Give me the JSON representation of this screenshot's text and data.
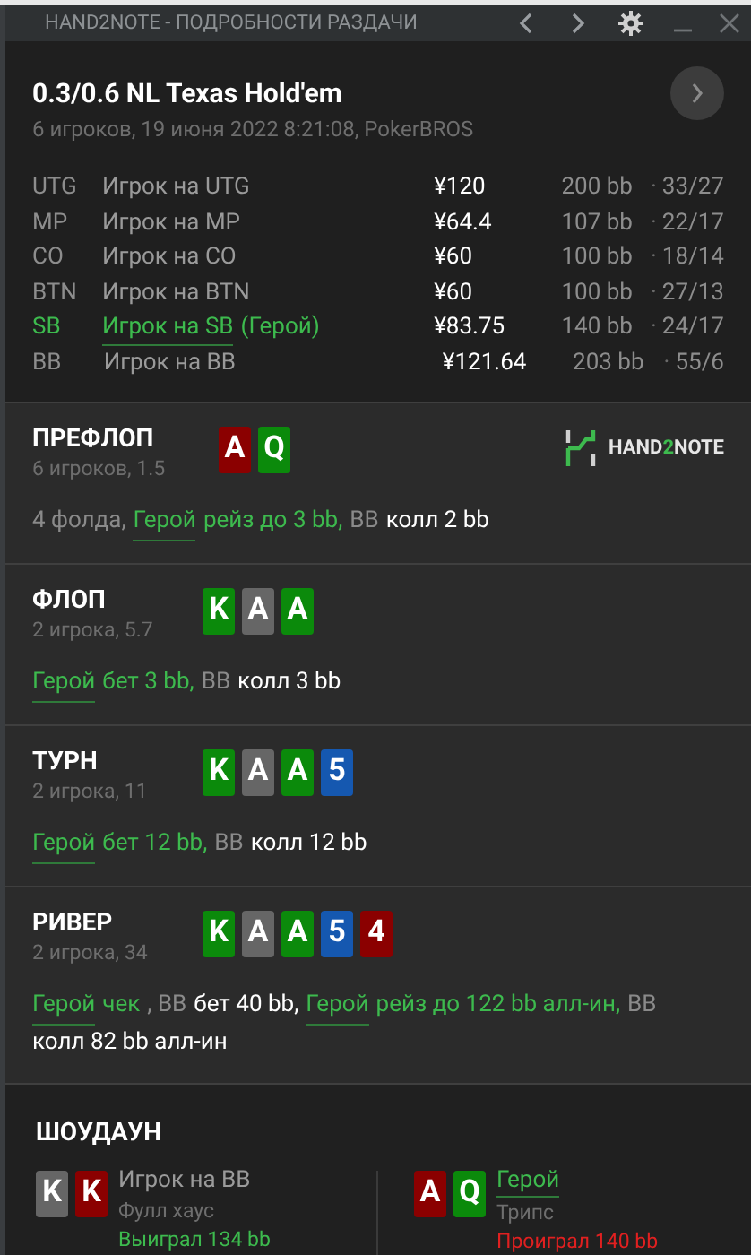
{
  "window": {
    "title": "HAND2NOTE - ПОДРОБНОСТИ РАЗДАЧИ"
  },
  "hand": {
    "title": "0.3/0.6 NL Texas Hold'em",
    "meta": "6 игроков, 19 июня 2022 8:21:08, PokerBROS"
  },
  "players": [
    {
      "position": "UTG",
      "name": "Игрок на UTG",
      "stack": "¥120",
      "bb": "200 bb",
      "separator": "·",
      "stats": "33/27",
      "hero": false
    },
    {
      "position": "MP",
      "name": "Игрок на MP",
      "stack": "¥64.4",
      "bb": "107 bb",
      "separator": "·",
      "stats": "22/17",
      "hero": false
    },
    {
      "position": "CO",
      "name": "Игрок на CO",
      "stack": "¥60",
      "bb": "100 bb",
      "separator": "·",
      "stats": "18/14",
      "hero": false
    },
    {
      "position": "BTN",
      "name": "Игрок на BTN",
      "stack": "¥60",
      "bb": "100 bb",
      "separator": "·",
      "stats": "27/13",
      "hero": false
    },
    {
      "position": "SB",
      "name": "Игрок на SB",
      "suffix": "(Герой)",
      "stack": "¥83.75",
      "bb": "140 bb",
      "separator": "·",
      "stats": "24/17",
      "hero": true
    },
    {
      "position": "BB",
      "name": "Игрок на BB",
      "stack": "¥121.64",
      "bb": "203 bb",
      "separator": "·",
      "stats": "55/6",
      "hero": false
    }
  ],
  "logo": {
    "before": "HAND",
    "accent": "2",
    "after": "NOTE"
  },
  "streets": [
    {
      "name": "ПРЕФЛОП",
      "meta": "6 игроков, 1.5",
      "cards": [
        {
          "rank": "A",
          "color": "#8b0000"
        },
        {
          "rank": "Q",
          "color": "#0b8a0b"
        }
      ],
      "actions": [
        {
          "kind": "muted",
          "text": "4 фолда,"
        },
        {
          "kind": "hero",
          "text": "Герой"
        },
        {
          "kind": "hero_action",
          "text": "рейз до 3 bb,"
        },
        {
          "kind": "muted",
          "text": "BB"
        },
        {
          "kind": "action",
          "text": "колл 2 bb"
        }
      ]
    },
    {
      "name": "ФЛОП",
      "meta": "2 игрока, 5.7",
      "cards": [
        {
          "rank": "K",
          "color": "#0b8a0b"
        },
        {
          "rank": "A",
          "color": "#666666"
        },
        {
          "rank": "A",
          "color": "#0b8a0b"
        }
      ],
      "actions": [
        {
          "kind": "hero",
          "text": "Герой"
        },
        {
          "kind": "hero_action",
          "text": "бет 3 bb,"
        },
        {
          "kind": "muted",
          "text": "BB"
        },
        {
          "kind": "action",
          "text": "колл 3 bb"
        }
      ]
    },
    {
      "name": "ТУРН",
      "meta": "2 игрока, 11",
      "cards": [
        {
          "rank": "K",
          "color": "#0b8a0b"
        },
        {
          "rank": "A",
          "color": "#666666"
        },
        {
          "rank": "A",
          "color": "#0b8a0b"
        },
        {
          "rank": "5",
          "color": "#1558b0"
        }
      ],
      "actions": [
        {
          "kind": "hero",
          "text": "Герой"
        },
        {
          "kind": "hero_action",
          "text": "бет 12 bb,"
        },
        {
          "kind": "muted",
          "text": "BB"
        },
        {
          "kind": "action",
          "text": "колл 12 bb"
        }
      ]
    },
    {
      "name": "РИВЕР",
      "meta": "2 игрока, 34",
      "cards": [
        {
          "rank": "K",
          "color": "#0b8a0b"
        },
        {
          "rank": "A",
          "color": "#666666"
        },
        {
          "rank": "A",
          "color": "#0b8a0b"
        },
        {
          "rank": "5",
          "color": "#1558b0"
        },
        {
          "rank": "4",
          "color": "#8b0000"
        }
      ],
      "actions": [
        {
          "kind": "hero",
          "text": "Герой"
        },
        {
          "kind": "hero_action",
          "text": "чек"
        },
        {
          "kind": "muted",
          "text": ", BB"
        },
        {
          "kind": "action",
          "text": "бет 40 bb,"
        },
        {
          "kind": "hero",
          "text": "Герой"
        },
        {
          "kind": "hero_action",
          "text": "рейз до 122 bb алл-ин,"
        },
        {
          "kind": "muted",
          "text": "BB"
        },
        {
          "kind": "action",
          "text": "колл 82 bb алл-ин"
        }
      ]
    }
  ],
  "showdown": {
    "title": "ШОУДАУН",
    "players": [
      {
        "cards": [
          {
            "rank": "K",
            "color": "#666666"
          },
          {
            "rank": "K",
            "color": "#8b0000"
          }
        ],
        "name": "Игрок на BB",
        "hero": false,
        "hand": "Фулл хаус",
        "result": "Выиграл 134 bb",
        "won": true
      },
      {
        "cards": [
          {
            "rank": "A",
            "color": "#8b0000"
          },
          {
            "rank": "Q",
            "color": "#0b8a0b"
          }
        ],
        "name": "Герой",
        "hero": true,
        "hand": "Трипс",
        "result": "Проиграл 140 bb",
        "won": false
      }
    ]
  }
}
